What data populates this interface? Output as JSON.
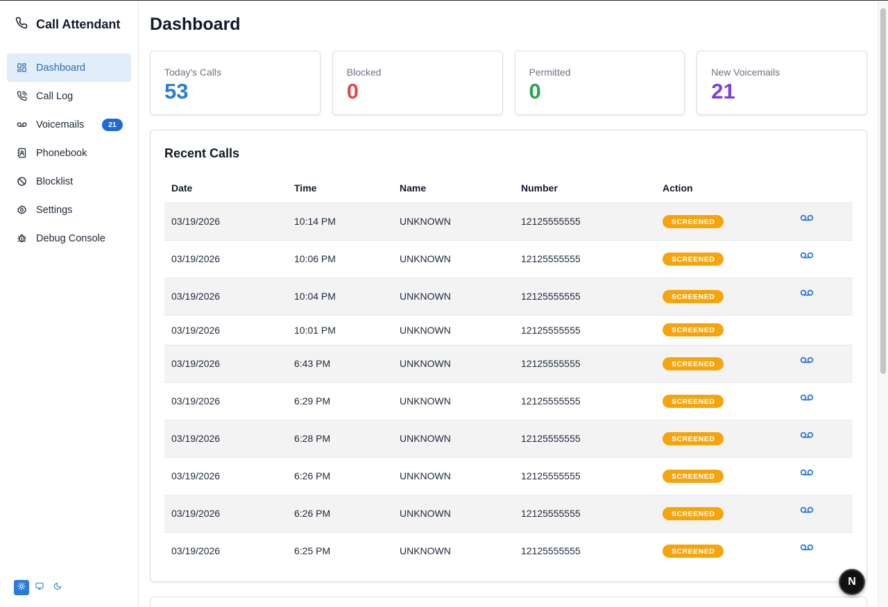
{
  "app": {
    "title": "Call Attendant",
    "icon": "phone-icon"
  },
  "sidebar": {
    "items": [
      {
        "label": "Dashboard",
        "icon": "dashboard-icon",
        "active": true
      },
      {
        "label": "Call Log",
        "icon": "phone-log-icon"
      },
      {
        "label": "Voicemails",
        "icon": "voicemail-icon",
        "badge": "21"
      },
      {
        "label": "Phonebook",
        "icon": "contacts-icon"
      },
      {
        "label": "Blocklist",
        "icon": "ban-icon"
      },
      {
        "label": "Settings",
        "icon": "gear-icon"
      },
      {
        "label": "Debug Console",
        "icon": "bug-icon"
      }
    ],
    "theme_options": [
      "sun-icon",
      "monitor-icon",
      "moon-icon"
    ],
    "theme_selected": "sun-icon"
  },
  "main": {
    "title": "Dashboard",
    "stats": [
      {
        "label": "Today's Calls",
        "value": "53",
        "color": "#2b7bd8"
      },
      {
        "label": "Blocked",
        "value": "0",
        "color": "#e04848"
      },
      {
        "label": "Permitted",
        "value": "0",
        "color": "#2ea24e"
      },
      {
        "label": "New Voicemails",
        "value": "21",
        "color": "#7a3fe0"
      }
    ],
    "recent": {
      "title": "Recent Calls",
      "columns": [
        "Date",
        "Time",
        "Name",
        "Number",
        "Action"
      ],
      "rows": [
        {
          "date": "03/19/2026",
          "time": "10:14 PM",
          "name": "UNKNOWN",
          "number": "12125555555",
          "action": "SCREENED",
          "voicemail": true
        },
        {
          "date": "03/19/2026",
          "time": "10:06 PM",
          "name": "UNKNOWN",
          "number": "12125555555",
          "action": "SCREENED",
          "voicemail": true
        },
        {
          "date": "03/19/2026",
          "time": "10:04 PM",
          "name": "UNKNOWN",
          "number": "12125555555",
          "action": "SCREENED",
          "voicemail": true
        },
        {
          "date": "03/19/2026",
          "time": "10:01 PM",
          "name": "UNKNOWN",
          "number": "12125555555",
          "action": "SCREENED",
          "voicemail": false
        },
        {
          "date": "03/19/2026",
          "time": "6:43 PM",
          "name": "UNKNOWN",
          "number": "12125555555",
          "action": "SCREENED",
          "voicemail": true
        },
        {
          "date": "03/19/2026",
          "time": "6:29 PM",
          "name": "UNKNOWN",
          "number": "12125555555",
          "action": "SCREENED",
          "voicemail": true
        },
        {
          "date": "03/19/2026",
          "time": "6:28 PM",
          "name": "UNKNOWN",
          "number": "12125555555",
          "action": "SCREENED",
          "voicemail": true
        },
        {
          "date": "03/19/2026",
          "time": "6:26 PM",
          "name": "UNKNOWN",
          "number": "12125555555",
          "action": "SCREENED",
          "voicemail": true
        },
        {
          "date": "03/19/2026",
          "time": "6:26 PM",
          "name": "UNKNOWN",
          "number": "12125555555",
          "action": "SCREENED",
          "voicemail": true
        },
        {
          "date": "03/19/2026",
          "time": "6:25 PM",
          "name": "UNKNOWN",
          "number": "12125555555",
          "action": "SCREENED",
          "voicemail": true
        }
      ]
    }
  },
  "overlay": {
    "badge_letter": "N"
  },
  "colors": {
    "accent": "#2b7bd8",
    "screened": "#f5a40c",
    "voicemail_icon": "#2b7bd8"
  }
}
